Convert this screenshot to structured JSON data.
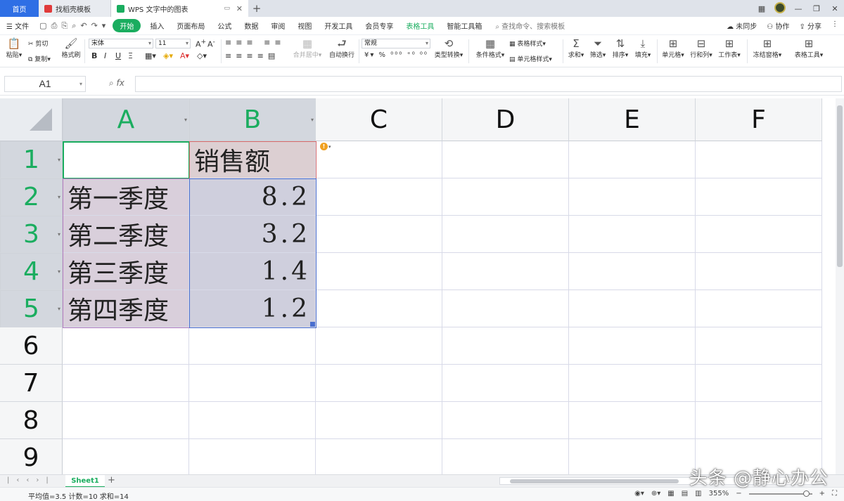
{
  "tabs": {
    "home": "首页",
    "tab1": "找稻壳模板",
    "tab2": "WPS 文字中的图表"
  },
  "menu": {
    "file": "文件",
    "items": [
      "开始",
      "插入",
      "页面布局",
      "公式",
      "数据",
      "审阅",
      "视图",
      "开发工具",
      "会员专享"
    ],
    "tool_items": [
      "表格工具",
      "智能工具箱"
    ],
    "search": "查找命令、搜索模板",
    "right": [
      "未同步",
      "协作",
      "分享"
    ]
  },
  "ribbon": {
    "paste": "粘贴",
    "cut": "剪切",
    "copy": "复制",
    "format_painter": "格式刷",
    "font_name": "宋体",
    "font_size": "11",
    "bold": "B",
    "italic": "I",
    "underline": "U",
    "merge": "合并居中",
    "wrap": "自动换行",
    "number_format": "常规",
    "type_convert": "类型转换",
    "cond_format": "条件格式",
    "table_style": "表格样式",
    "cell_style": "单元格样式",
    "sum": "求和",
    "filter": "筛选",
    "sort": "排序",
    "fill": "填充",
    "cells": "单元格",
    "rows_cols": "行和列",
    "worksheet": "工作表",
    "freeze": "冻结窗格",
    "table_tools": "表格工具"
  },
  "formula_bar": {
    "name_box": "A1",
    "fx": "fx",
    "content": ""
  },
  "columns": [
    "A",
    "B",
    "C",
    "D",
    "E",
    "F"
  ],
  "rows": [
    "1",
    "2",
    "3",
    "4",
    "5",
    "6",
    "7",
    "8",
    "9"
  ],
  "cells": {
    "A1": "",
    "B1": "销售额",
    "A2": "第一季度",
    "B2": "8.2",
    "A3": "第二季度",
    "B3": "3.2",
    "A4": "第三季度",
    "B4": "1.4",
    "A5": "第四季度",
    "B5": "1.2"
  },
  "sheet": {
    "name": "Sheet1"
  },
  "status": {
    "summary": "平均值=3.5  计数=10  求和=14",
    "zoom": "355%"
  },
  "watermark": "头条 @静心办公",
  "colors": {
    "accent": "#1aad5f",
    "selection": "#4a6fcf"
  }
}
